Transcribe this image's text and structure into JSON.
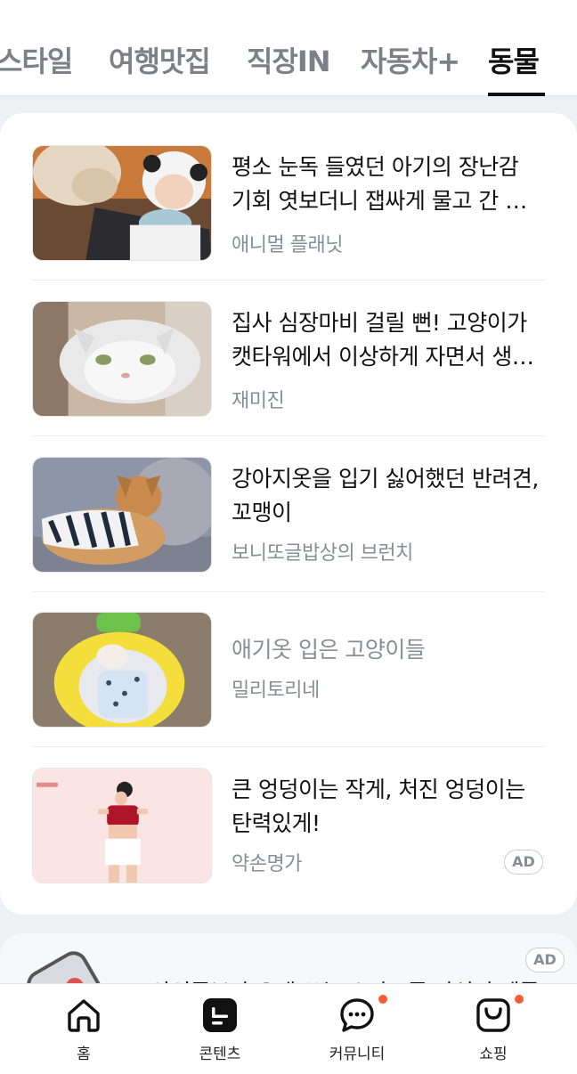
{
  "tabs": [
    {
      "label": "스타일",
      "active": false
    },
    {
      "label": "여행맛집",
      "active": false
    },
    {
      "label": "직장IN",
      "active": false
    },
    {
      "label": "자동차+",
      "active": false
    },
    {
      "label": "동물",
      "active": true
    }
  ],
  "feed": {
    "items": [
      {
        "title": "평소 눈독 들였던 아기의 장난감 기회 엿보더니 잽싸게 물고 간 댕댕이",
        "source": "애니멀 플래닛",
        "image": "dog-and-baby-photo",
        "read": false,
        "ad": false
      },
      {
        "title": "집사 심장마비 걸릴 뻔! 고양이가 캣타워에서 이상하게 자면서 생긴 일",
        "source": "재미진",
        "image": "white-cat-photo",
        "read": false,
        "ad": false
      },
      {
        "title": "강아지옷을 입기 싫어했던 반려견, 꼬맹이",
        "source": "보니또글밥상의 브런치",
        "image": "dog-in-striped-shirt-photo",
        "read": false,
        "ad": false
      },
      {
        "title": "애기옷 입은 고양이들",
        "source": "밀리토리네",
        "image": "cat-in-banana-bed-photo",
        "read": true,
        "ad": false
      },
      {
        "title": "큰 엉덩이는 작게, 처진 엉덩이는 탄력있게!",
        "source": "약손명가",
        "image": "woman-fitness-ad-photo",
        "read": false,
        "ad": true,
        "ad_label": "AD"
      }
    ]
  },
  "next_card": {
    "title": "아이폰보다 오래 쓰는 스마트폰 가성비 제품",
    "ad_label": "AD"
  },
  "bottom_nav": [
    {
      "label": "홈",
      "icon": "home-icon",
      "dot": false
    },
    {
      "label": "콘텐츠",
      "icon": "contents-icon",
      "dot": false
    },
    {
      "label": "커뮤니티",
      "icon": "chat-bubble-icon",
      "dot": true
    },
    {
      "label": "쇼핑",
      "icon": "shopping-bag-icon",
      "dot": true
    }
  ],
  "colors": {
    "accent": "#111111",
    "notification_dot": "#ff5a33",
    "muted_text": "#8a8d93"
  }
}
